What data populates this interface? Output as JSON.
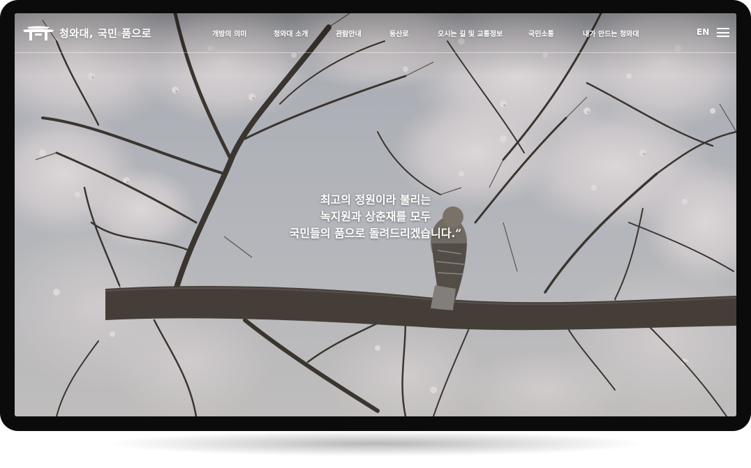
{
  "site": {
    "logo_text": "청와대, 국민 품으로"
  },
  "nav": {
    "items": [
      {
        "label": "개방의 의미"
      },
      {
        "label": "청와대 소개"
      },
      {
        "label": "관람안내"
      },
      {
        "label": "등산로"
      },
      {
        "label": "오시는 길 및 교통정보"
      },
      {
        "label": "국민소통"
      },
      {
        "label": "내가 만드는 청와대"
      }
    ],
    "lang_label": "EN"
  },
  "hero": {
    "quote_lines": [
      "최고의 정원이라 불리는",
      "녹지원과 상춘재를 모두",
      "국민들의 품으로 돌려드리겠습니다.”"
    ]
  },
  "colors": {
    "frame": "#0b0b0b",
    "sky": "#c9cdd3",
    "branch": "#4a423c",
    "blossom": "#efe8ea",
    "text": "#ffffff"
  },
  "icons": {
    "logo": "gate-roof-icon",
    "menu": "hamburger-menu-icon"
  }
}
